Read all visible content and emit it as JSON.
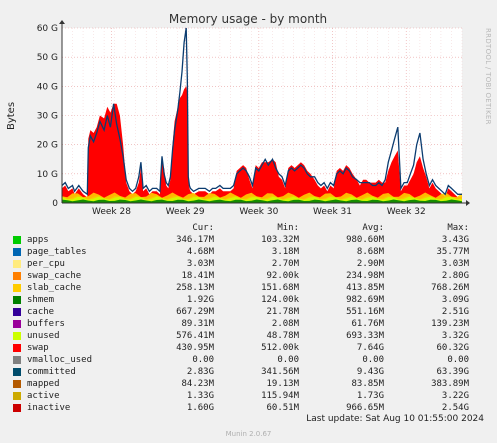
{
  "chart_data": {
    "type": "area",
    "title": "Memory usage - by month",
    "ylabel": "Bytes",
    "side_label": "RRDTOOL / TOBI OETIKER",
    "ylim": [
      0,
      60
    ],
    "y_unit": "G",
    "yticks": [
      "0",
      "10 G",
      "20 G",
      "30 G",
      "40 G",
      "50 G",
      "60 G"
    ],
    "ytick_values": [
      0,
      10,
      20,
      30,
      40,
      50,
      60
    ],
    "xlim": [
      0,
      38
    ],
    "x_unit": "days since start of graph",
    "xticks": [
      {
        "label": "Week 28",
        "x": 4.7
      },
      {
        "label": "Week 29",
        "x": 11.7
      },
      {
        "label": "Week 30",
        "x": 18.7
      },
      {
        "label": "Week 31",
        "x": 25.7
      },
      {
        "label": "Week 32",
        "x": 32.7
      }
    ],
    "colors": {
      "swap": "#ff0000",
      "committed": "#0b3c70",
      "apps": "#00cc00",
      "unused": "#ccff00",
      "slab_cache": "#ffcc00",
      "shmem": "#008000",
      "active": "#ccaa00",
      "inactive": "#cc0000",
      "buffers": "#990099",
      "grid": "#e8a0a0"
    },
    "swap_x": [
      0,
      0.3,
      0.6,
      1.0,
      1.2,
      1.4,
      1.6,
      1.8,
      2.0,
      2.4,
      2.5,
      2.7,
      3.0,
      3.3,
      3.6,
      4.0,
      4.3,
      4.6,
      4.9,
      5.2,
      5.5,
      5.8,
      6.1,
      6.4,
      6.7,
      7.0,
      7.3,
      7.5,
      7.7,
      8.0,
      8.3,
      8.6,
      9.0,
      9.3,
      9.5,
      9.7,
      9.9,
      10.1,
      10.3,
      10.5,
      10.7,
      11.0,
      11.2,
      11.4,
      11.6,
      11.8,
      11.9,
      12.0,
      12.1,
      12.2,
      12.5,
      13.0,
      13.3,
      13.6,
      14.0,
      14.3,
      14.6,
      15.0,
      15.3,
      15.6,
      16.0,
      16.3,
      16.6,
      16.9,
      17.2,
      17.5,
      17.8,
      18.1,
      18.4,
      18.7,
      19.0,
      19.3,
      19.6,
      20.0,
      20.3,
      20.6,
      20.9,
      21.2,
      21.5,
      21.8,
      22.1,
      22.4,
      22.7,
      23.0,
      23.3,
      23.6,
      24.0,
      24.3,
      24.6,
      24.9,
      25.2,
      25.5,
      25.8,
      26.1,
      26.4,
      26.7,
      27.0,
      27.3,
      27.6,
      28.0,
      28.3,
      28.6,
      28.9,
      29.2,
      29.5,
      29.8,
      30.1,
      30.4,
      30.7,
      31.0,
      31.3,
      31.6,
      31.9,
      32.2,
      32.5,
      32.8,
      33.1,
      33.4,
      33.7,
      34.0,
      34.3,
      34.6,
      34.9,
      35.2,
      35.5,
      35.8,
      36.1,
      36.4,
      36.7,
      37.0,
      37.3,
      37.6,
      38.0
    ],
    "swap_y": [
      5,
      6,
      4,
      5,
      3,
      4,
      5,
      4,
      3,
      2,
      22,
      25,
      24,
      26,
      30,
      29,
      33,
      31,
      34,
      34,
      30,
      20,
      7,
      4,
      3,
      4,
      7,
      12,
      4,
      5,
      3,
      4,
      4,
      3,
      14,
      12,
      6,
      5,
      8,
      20,
      28,
      33,
      36,
      37,
      39,
      40,
      38,
      8,
      5,
      4,
      3,
      4,
      4,
      4,
      3,
      4,
      4,
      5,
      4,
      4,
      4,
      5,
      11,
      12,
      13,
      12,
      8,
      5,
      13,
      12,
      14,
      14,
      14,
      15,
      14,
      9,
      8,
      5,
      12,
      13,
      12,
      13,
      14,
      13,
      11,
      10,
      8,
      6,
      5,
      6,
      4,
      6,
      5,
      11,
      12,
      11,
      13,
      12,
      10,
      8,
      6,
      8,
      8,
      7,
      7,
      7,
      8,
      7,
      7,
      11,
      14,
      16,
      18,
      4,
      6,
      6,
      8,
      10,
      14,
      16,
      12,
      9,
      5,
      7,
      5,
      4,
      3,
      2,
      5,
      4,
      3,
      2,
      2
    ],
    "committed_x": [
      0,
      0.3,
      0.6,
      1.0,
      1.2,
      1.4,
      1.6,
      1.8,
      2.0,
      2.4,
      2.5,
      2.7,
      3.0,
      3.3,
      3.6,
      4.0,
      4.3,
      4.6,
      4.9,
      5.2,
      5.5,
      5.8,
      6.1,
      6.4,
      6.7,
      7.0,
      7.3,
      7.5,
      7.7,
      8.0,
      8.3,
      8.6,
      9.0,
      9.3,
      9.5,
      9.7,
      9.9,
      10.1,
      10.3,
      10.5,
      10.7,
      11.0,
      11.2,
      11.4,
      11.6,
      11.8,
      11.9,
      12.0,
      12.1,
      12.2,
      12.5,
      13.0,
      13.3,
      13.6,
      14.0,
      14.3,
      14.6,
      15.0,
      15.3,
      15.6,
      16.0,
      16.3,
      16.6,
      16.9,
      17.2,
      17.5,
      17.8,
      18.1,
      18.4,
      18.7,
      19.0,
      19.3,
      19.6,
      20.0,
      20.3,
      20.6,
      20.9,
      21.2,
      21.5,
      21.8,
      22.1,
      22.4,
      22.7,
      23.0,
      23.3,
      23.6,
      24.0,
      24.3,
      24.6,
      24.9,
      25.2,
      25.5,
      25.8,
      26.1,
      26.4,
      26.7,
      27.0,
      27.3,
      27.6,
      28.0,
      28.3,
      28.6,
      28.9,
      29.2,
      29.5,
      29.8,
      30.1,
      30.4,
      30.7,
      31.0,
      31.3,
      31.6,
      31.9,
      32.2,
      32.5,
      32.8,
      33.1,
      33.4,
      33.7,
      34.0,
      34.3,
      34.6,
      34.9,
      35.2,
      35.5,
      35.8,
      36.1,
      36.4,
      36.7,
      37.0,
      37.3,
      37.6,
      38.0
    ],
    "committed_y": [
      6,
      7,
      5,
      6,
      4,
      5,
      6,
      5,
      4,
      3,
      19,
      23,
      21,
      24,
      28,
      25,
      30,
      26,
      34,
      27,
      22,
      16,
      8,
      5,
      4,
      5,
      9,
      14,
      5,
      6,
      4,
      5,
      5,
      4,
      16,
      10,
      7,
      6,
      9,
      18,
      25,
      32,
      38,
      45,
      55,
      60,
      43,
      9,
      6,
      5,
      4,
      5,
      5,
      5,
      4,
      5,
      5,
      6,
      5,
      5,
      5,
      6,
      10,
      11,
      12,
      11,
      9,
      6,
      12,
      11,
      13,
      15,
      13,
      15,
      12,
      10,
      9,
      6,
      11,
      12,
      11,
      12,
      13,
      12,
      10,
      9,
      9,
      7,
      6,
      7,
      5,
      7,
      6,
      10,
      11,
      10,
      12,
      11,
      9,
      8,
      7,
      7,
      7,
      7,
      6,
      6,
      7,
      6,
      8,
      14,
      18,
      22,
      26,
      5,
      7,
      7,
      10,
      13,
      20,
      24,
      15,
      10,
      6,
      8,
      6,
      5,
      4,
      3,
      6,
      5,
      4,
      3,
      3
    ]
  },
  "legend": {
    "headers": [
      "Cur:",
      "Min:",
      "Avg:",
      "Max:"
    ],
    "rows": [
      {
        "name": "apps",
        "color": "#00cc00",
        "cur": "346.17M",
        "min": "103.32M",
        "avg": "980.60M",
        "max": "3.43G"
      },
      {
        "name": "page_tables",
        "color": "#0066b3",
        "cur": "4.68M",
        "min": "3.18M",
        "avg": "8.68M",
        "max": "35.77M"
      },
      {
        "name": "per_cpu",
        "color": "#ffeb7f",
        "cur": "3.03M",
        "min": "2.70M",
        "avg": "2.90M",
        "max": "3.03M"
      },
      {
        "name": "swap_cache",
        "color": "#ff8000",
        "cur": "18.41M",
        "min": "92.00k",
        "avg": "234.98M",
        "max": "2.80G"
      },
      {
        "name": "slab_cache",
        "color": "#ffcc00",
        "cur": "258.13M",
        "min": "151.68M",
        "avg": "413.85M",
        "max": "768.26M"
      },
      {
        "name": "shmem",
        "color": "#008000",
        "cur": "1.92G",
        "min": "124.00k",
        "avg": "982.69M",
        "max": "3.09G"
      },
      {
        "name": "cache",
        "color": "#330099",
        "cur": "667.29M",
        "min": "21.78M",
        "avg": "551.16M",
        "max": "2.51G"
      },
      {
        "name": "buffers",
        "color": "#990099",
        "cur": "89.31M",
        "min": "2.08M",
        "avg": "61.76M",
        "max": "139.23M"
      },
      {
        "name": "unused",
        "color": "#ccff00",
        "cur": "576.41M",
        "min": "48.78M",
        "avg": "693.33M",
        "max": "3.32G"
      },
      {
        "name": "swap",
        "color": "#ff0000",
        "cur": "430.95M",
        "min": "512.00k",
        "avg": "7.64G",
        "max": "60.32G"
      },
      {
        "name": "vmalloc_used",
        "color": "#808080",
        "cur": "0.00",
        "min": "0.00",
        "avg": "0.00",
        "max": "0.00"
      },
      {
        "name": "committed",
        "color": "#004c6b",
        "cur": "2.83G",
        "min": "341.56M",
        "avg": "9.43G",
        "max": "63.39G"
      },
      {
        "name": "mapped",
        "color": "#b35900",
        "cur": "84.23M",
        "min": "19.13M",
        "avg": "83.85M",
        "max": "383.89M"
      },
      {
        "name": "active",
        "color": "#ccaa00",
        "cur": "1.33G",
        "min": "115.94M",
        "avg": "1.73G",
        "max": "3.22G"
      },
      {
        "name": "inactive",
        "color": "#cc0000",
        "cur": "1.60G",
        "min": "60.51M",
        "avg": "966.65M",
        "max": "2.54G"
      }
    ]
  },
  "footer": {
    "last_update": "Last update: Sat Aug 10 01:55:00 2024",
    "credit": "Munin 2.0.67"
  }
}
